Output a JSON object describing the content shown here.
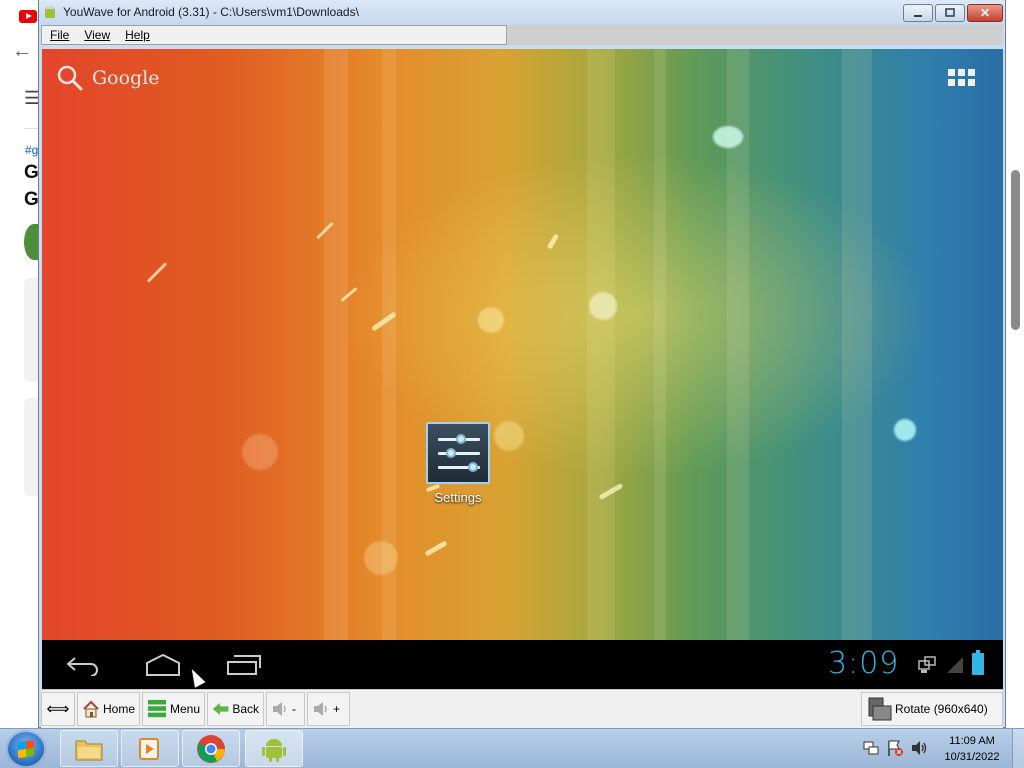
{
  "background_page": {
    "hash_fragment": "#g",
    "title_fragments": [
      "G",
      "G"
    ]
  },
  "window": {
    "title": "YouWave for Android (3.31) - C:\\Users\\vm1\\Downloads\\",
    "close_symbol": "✕"
  },
  "menu": {
    "items": [
      "File",
      "View",
      "Help"
    ]
  },
  "android": {
    "search_label": "Google",
    "settings_label": "Settings",
    "clock": "3:09"
  },
  "toolbar": {
    "home_label": "Home",
    "menu_label": "Menu",
    "back_label": "Back",
    "vol_down_label": "-",
    "vol_up_label": "+",
    "rotate_label": "Rotate (960x640)"
  },
  "taskbar": {
    "time": "11:09 AM",
    "date": "10/31/2022"
  },
  "colors": {
    "android_accent": "#33b5e5",
    "window_frame": "#c9dcf2"
  }
}
